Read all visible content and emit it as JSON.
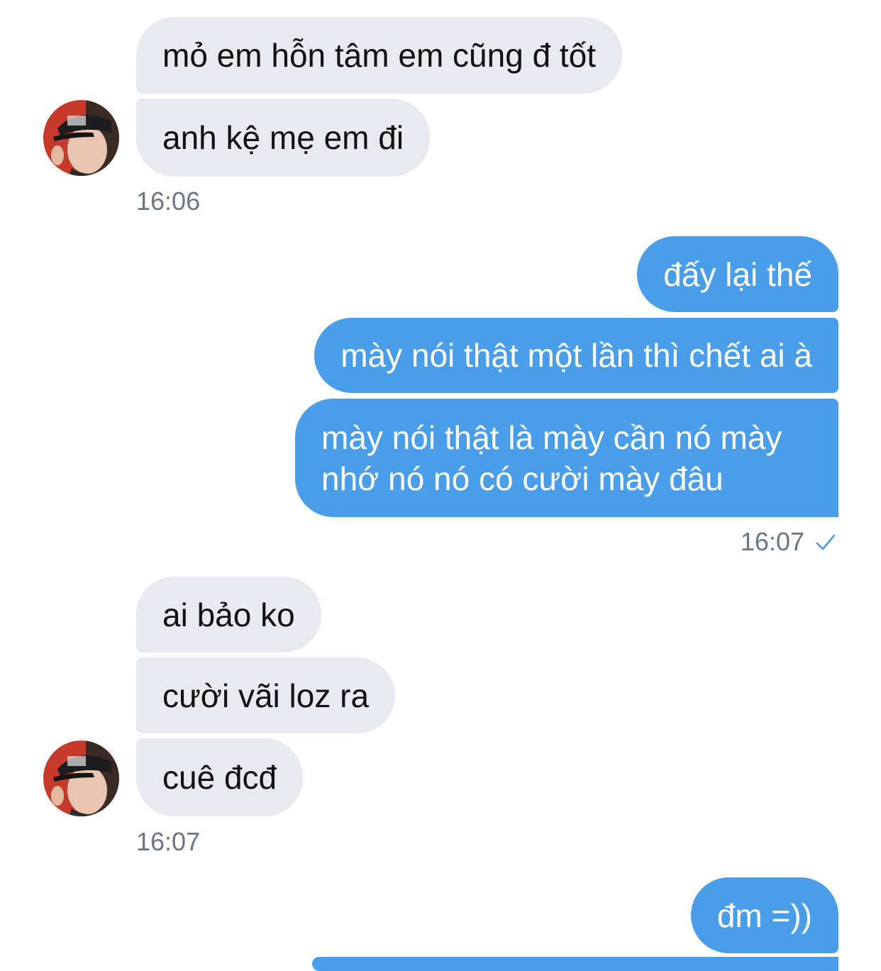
{
  "conversation": {
    "colors": {
      "incoming_bubble": "#e8eaef",
      "outgoing_bubble": "#4a9de9",
      "timestamp": "#6b7684",
      "read_check": "#4a9de9"
    },
    "group1": {
      "messages": [
        "mỏ em hỗn tâm em cũng đ tốt",
        "anh kệ mẹ em đi"
      ],
      "time": "16:06"
    },
    "group2": {
      "messages": [
        "đấy lại thế",
        "mày nói thật một lần thì chết ai à"
      ],
      "multiline_message": {
        "line1": "mày nói thật là mày cần nó mày",
        "line2": "nhớ nó nó có cười mày đâu"
      },
      "time": "16:07",
      "status_icon": "read-check-icon"
    },
    "group3": {
      "messages": [
        "ai bảo ko",
        "cười vãi loz ra",
        "cuê đcđ"
      ],
      "time": "16:07"
    },
    "group4": {
      "messages": [
        "đm =))"
      ]
    }
  }
}
